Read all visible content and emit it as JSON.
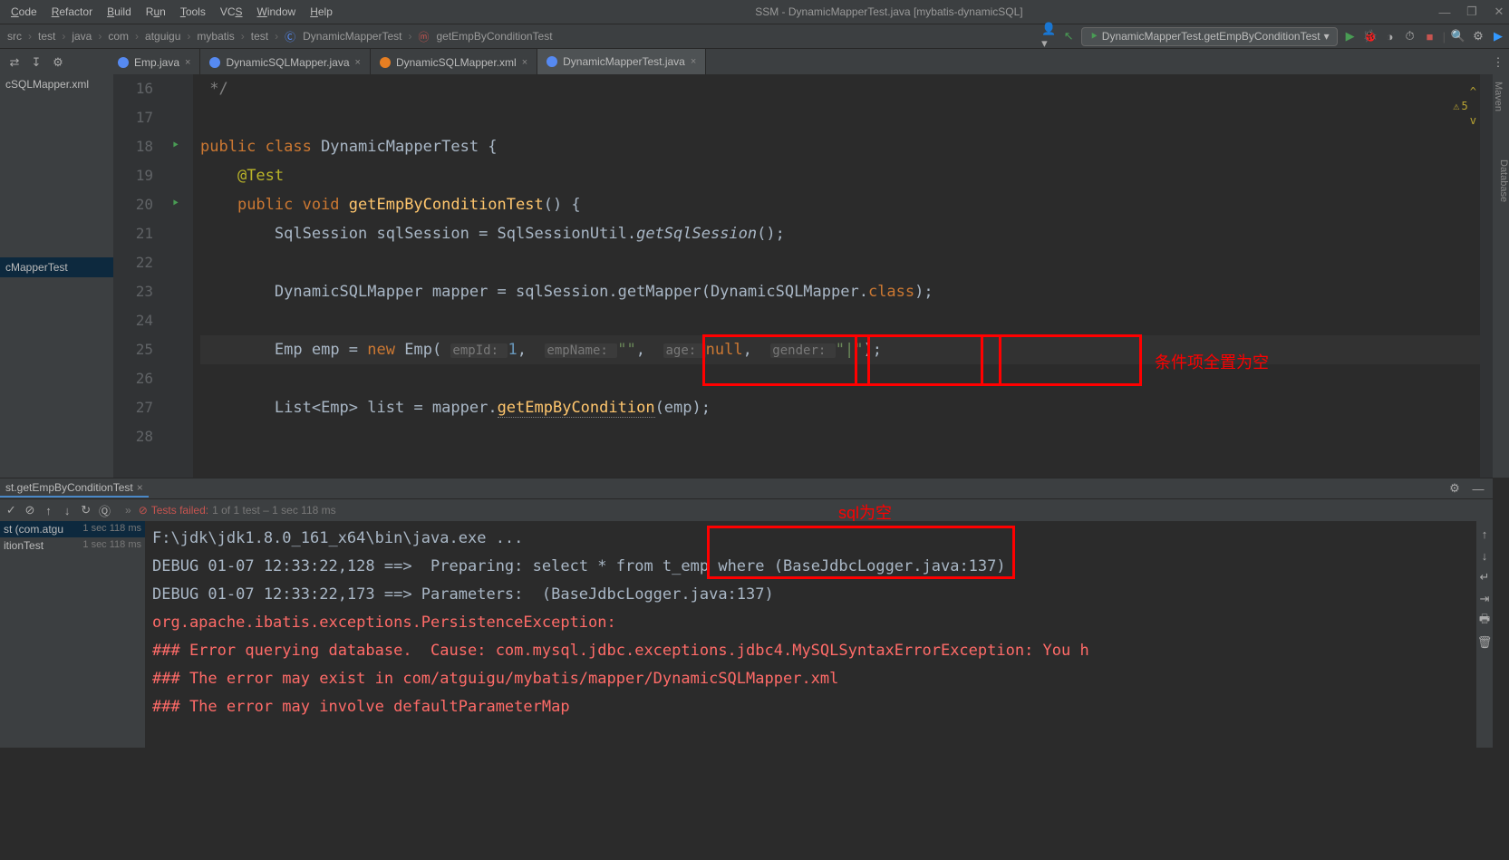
{
  "title": "SSM - DynamicMapperTest.java [mybatis-dynamicSQL]",
  "menus": [
    "Code",
    "Refactor",
    "Build",
    "Run",
    "Tools",
    "VCS",
    "Window",
    "Help"
  ],
  "breadcrumbs": [
    "src",
    "test",
    "java",
    "com",
    "atguigu",
    "mybatis",
    "test",
    "DynamicMapperTest",
    "getEmpByConditionTest"
  ],
  "runConfig": "DynamicMapperTest.getEmpByConditionTest",
  "editorTabs": [
    {
      "label": "Emp.java",
      "type": "c"
    },
    {
      "label": "DynamicSQLMapper.java",
      "type": "java"
    },
    {
      "label": "DynamicSQLMapper.xml",
      "type": "xml"
    },
    {
      "label": "DynamicMapperTest.java",
      "type": "java",
      "active": true
    }
  ],
  "sidebarItems": [
    "cSQLMapper.xml",
    "cMapperTest"
  ],
  "warningCount": "5",
  "code": {
    "start": 16,
    "commentEnd": " */",
    "cls": "DynamicMapperTest",
    "method": "getEmpByConditionTest",
    "line25": {
      "empId": "1",
      "empName": "\"\"",
      "age": "null",
      "gender": "\"|\""
    },
    "getEmpByCondition": "getEmpByCondition"
  },
  "redLabel1": "条件项全置为空",
  "redLabel2": "sql为空",
  "runTabLabel": "st.getEmpByConditionTest",
  "testStatus": {
    "label": "Tests failed:",
    "detail": "1 of 1 test – 1 sec 118 ms"
  },
  "runTree": [
    {
      "label": "st (com.atgu",
      "time": "1 sec 118 ms"
    },
    {
      "label": "itionTest",
      "time": "1 sec 118 ms"
    }
  ],
  "console": {
    "l1": "F:\\jdk\\jdk1.8.0_161_x64\\bin\\java.exe ...",
    "l2a": "DEBUG 01-07 12:33:22,128 ==>  Preparing: ",
    "l2b": "select * from t_emp where ",
    "l2c": "(BaseJdbcLogger.java:137)",
    "l3": "DEBUG 01-07 12:33:22,173 ==> Parameters:  (BaseJdbcLogger.java:137)",
    "e1": "org.apache.ibatis.exceptions.PersistenceException: ",
    "e2": "### Error querying database.  Cause: com.mysql.jdbc.exceptions.jdbc4.MySQLSyntaxErrorException: You h",
    "e3": "### The error may exist in com/atguigu/mybatis/mapper/DynamicSQLMapper.xml",
    "e4": "### The error may involve defaultParameterMap"
  },
  "rightTool": "Database",
  "mavenLabel": "Maven",
  "mavenM": "m"
}
